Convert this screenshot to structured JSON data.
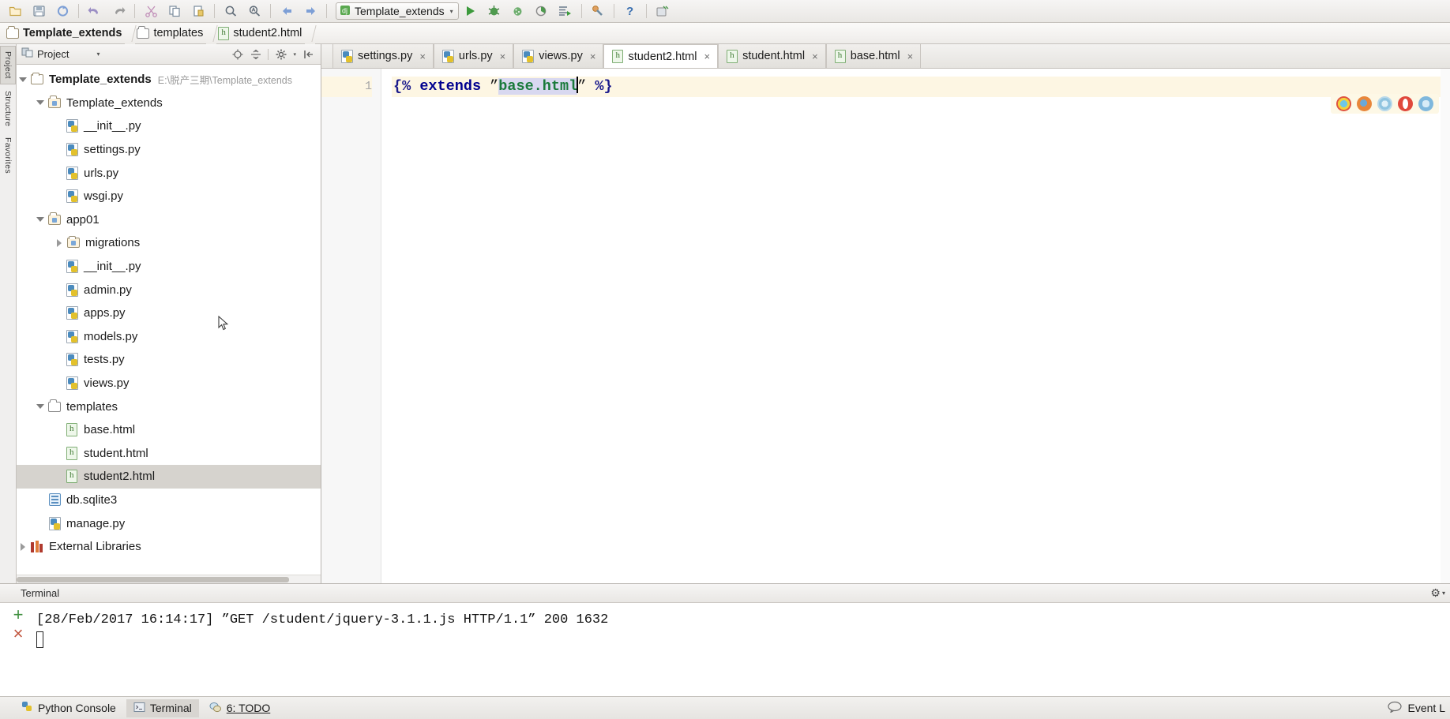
{
  "toolbar": {
    "buttons": [
      {
        "name": "open-icon",
        "glyph": "◱"
      },
      {
        "name": "save-icon",
        "glyph": "💾"
      },
      {
        "name": "sync-icon",
        "glyph": "↻"
      },
      {
        "name": "undo-icon",
        "glyph": "↶"
      },
      {
        "name": "redo-icon",
        "glyph": "↷"
      },
      {
        "name": "cut-icon",
        "glyph": "✂"
      },
      {
        "name": "copy-icon",
        "glyph": "⧉"
      },
      {
        "name": "paste-icon",
        "glyph": "📋"
      },
      {
        "name": "find-icon",
        "glyph": "🔍"
      },
      {
        "name": "replace-icon",
        "glyph": "🔎"
      },
      {
        "name": "back-icon",
        "glyph": "⇦"
      },
      {
        "name": "forward-icon",
        "glyph": "⇨"
      }
    ],
    "run_config": {
      "label": "Template_extends",
      "caret": "▾"
    },
    "run_buttons": [
      {
        "name": "run-icon",
        "glyph": "▶"
      },
      {
        "name": "debug-icon",
        "glyph": "🐞"
      },
      {
        "name": "coverage-icon",
        "glyph": "⚫"
      },
      {
        "name": "profile-icon",
        "glyph": "◑"
      },
      {
        "name": "run-with-console-icon",
        "glyph": "☰"
      }
    ],
    "right_buttons": [
      {
        "name": "settings-icon",
        "glyph": "🔧"
      },
      {
        "name": "help-icon",
        "glyph": "?"
      },
      {
        "name": "vcs-update-icon",
        "glyph": "🖨"
      }
    ]
  },
  "breadcrumb": {
    "items": [
      {
        "label": "Template_extends",
        "icon": "folder-icon"
      },
      {
        "label": "templates",
        "icon": "folder-icon"
      },
      {
        "label": "student2.html",
        "icon": "html-file-icon"
      }
    ]
  },
  "left_tool_tabs": [
    {
      "label": "Project",
      "active": true
    },
    {
      "label": "Structure",
      "active": false
    },
    {
      "label": "Favorites",
      "active": false
    }
  ],
  "project_panel": {
    "title": "Project",
    "caret": "▾",
    "tools": [
      {
        "name": "scroll-from-source-icon",
        "glyph": "⌖"
      },
      {
        "name": "collapse-all-icon",
        "glyph": "⨍"
      },
      {
        "name": "settings-gear-icon",
        "glyph": "⚙"
      },
      {
        "name": "hide-panel-icon",
        "glyph": "⇤"
      }
    ],
    "tree": [
      {
        "label": "Template_extends",
        "path": "E:\\脱产三期\\Template_extends",
        "indent": 0,
        "arrow": "down",
        "icon": "folder-icon",
        "bold": true,
        "selected": false
      },
      {
        "label": "Template_extends",
        "path": "",
        "indent": 1,
        "arrow": "down",
        "icon": "source-folder-icon",
        "bold": false,
        "selected": false
      },
      {
        "label": "__init__.py",
        "path": "",
        "indent": 2,
        "arrow": "none",
        "icon": "python-file-icon",
        "bold": false,
        "selected": false
      },
      {
        "label": "settings.py",
        "path": "",
        "indent": 2,
        "arrow": "none",
        "icon": "python-file-icon",
        "bold": false,
        "selected": false
      },
      {
        "label": "urls.py",
        "path": "",
        "indent": 2,
        "arrow": "none",
        "icon": "python-file-icon",
        "bold": false,
        "selected": false
      },
      {
        "label": "wsgi.py",
        "path": "",
        "indent": 2,
        "arrow": "none",
        "icon": "python-file-icon",
        "bold": false,
        "selected": false
      },
      {
        "label": "app01",
        "path": "",
        "indent": 1,
        "arrow": "down",
        "icon": "source-folder-icon",
        "bold": false,
        "selected": false
      },
      {
        "label": "migrations",
        "path": "",
        "indent": 2,
        "arrow": "right",
        "icon": "source-folder-icon",
        "bold": false,
        "selected": false
      },
      {
        "label": "__init__.py",
        "path": "",
        "indent": 2,
        "arrow": "none",
        "icon": "python-file-icon",
        "bold": false,
        "selected": false
      },
      {
        "label": "admin.py",
        "path": "",
        "indent": 2,
        "arrow": "none",
        "icon": "python-file-icon",
        "bold": false,
        "selected": false
      },
      {
        "label": "apps.py",
        "path": "",
        "indent": 2,
        "arrow": "none",
        "icon": "python-file-icon",
        "bold": false,
        "selected": false
      },
      {
        "label": "models.py",
        "path": "",
        "indent": 2,
        "arrow": "none",
        "icon": "python-file-icon",
        "bold": false,
        "selected": false
      },
      {
        "label": "tests.py",
        "path": "",
        "indent": 2,
        "arrow": "none",
        "icon": "python-file-icon",
        "bold": false,
        "selected": false
      },
      {
        "label": "views.py",
        "path": "",
        "indent": 2,
        "arrow": "none",
        "icon": "python-file-icon",
        "bold": false,
        "selected": false
      },
      {
        "label": "templates",
        "path": "",
        "indent": 1,
        "arrow": "down",
        "icon": "folder-plain-icon",
        "bold": false,
        "selected": false
      },
      {
        "label": "base.html",
        "path": "",
        "indent": 2,
        "arrow": "none",
        "icon": "html-file-icon",
        "bold": false,
        "selected": false
      },
      {
        "label": "student.html",
        "path": "",
        "indent": 2,
        "arrow": "none",
        "icon": "html-file-icon",
        "bold": false,
        "selected": false
      },
      {
        "label": "student2.html",
        "path": "",
        "indent": 2,
        "arrow": "none",
        "icon": "html-file-icon",
        "bold": false,
        "selected": true
      },
      {
        "label": "db.sqlite3",
        "path": "",
        "indent": 1,
        "arrow": "none",
        "icon": "database-file-icon",
        "bold": false,
        "selected": false
      },
      {
        "label": "manage.py",
        "path": "",
        "indent": 1,
        "arrow": "none",
        "icon": "python-file-icon",
        "bold": false,
        "selected": false
      },
      {
        "label": "External Libraries",
        "path": "",
        "indent": 0,
        "arrow": "right",
        "icon": "libraries-icon",
        "bold": false,
        "selected": false
      }
    ]
  },
  "editor": {
    "tabs": [
      {
        "label": "settings.py",
        "icon": "python-file-icon",
        "close": "×",
        "active": false
      },
      {
        "label": "urls.py",
        "icon": "python-file-icon",
        "close": "×",
        "active": false
      },
      {
        "label": "views.py",
        "icon": "python-file-icon",
        "close": "×",
        "active": false
      },
      {
        "label": "student2.html",
        "icon": "html-file-icon",
        "close": "×",
        "active": true
      },
      {
        "label": "student.html",
        "icon": "html-file-icon",
        "close": "×",
        "active": false
      },
      {
        "label": "base.html",
        "icon": "html-file-icon",
        "close": "×",
        "active": false
      }
    ],
    "line_number": "1",
    "code": {
      "open_tag": "{%",
      "keyword": "extends",
      "open_quote": "”",
      "string": "base.html",
      "close_quote": "”",
      "close_tag": "%}"
    },
    "browsers": [
      {
        "name": "chrome-browser-icon",
        "color": "#d9d34a"
      },
      {
        "name": "firefox-browser-icon",
        "color": "#e8863a"
      },
      {
        "name": "safari-browser-icon",
        "color": "#8fc4e0"
      },
      {
        "name": "opera-browser-icon",
        "color": "#e0483c"
      },
      {
        "name": "internet-explorer-browser-icon",
        "color": "#7fb8dd"
      }
    ]
  },
  "terminal": {
    "title": "Terminal",
    "gear": "⚙",
    "gear_caret": "▾",
    "new_session": "+",
    "close_session": "×",
    "lines": [
      "[28/Feb/2017 16:14:17] ”GET /student/jquery-3.1.1.js HTTP/1.1” 200 1632"
    ]
  },
  "statusbar": {
    "items": [
      {
        "label": "Python Console",
        "icon": "python-console-icon",
        "active": false
      },
      {
        "label": "Terminal",
        "icon": "terminal-icon",
        "active": true
      },
      {
        "label": "6: TODO",
        "icon": "todo-icon",
        "active": false
      }
    ],
    "right": {
      "event_log": "Event L",
      "event_log_icon": "speech-bubble-icon"
    }
  },
  "colors": {
    "accent_selection": "#d6d3ce",
    "code_line_highlight": "#fdf6e3",
    "string_token": "#1a7a3c",
    "keyword_token": "#00008f",
    "panel_bg": "#f0efee"
  }
}
